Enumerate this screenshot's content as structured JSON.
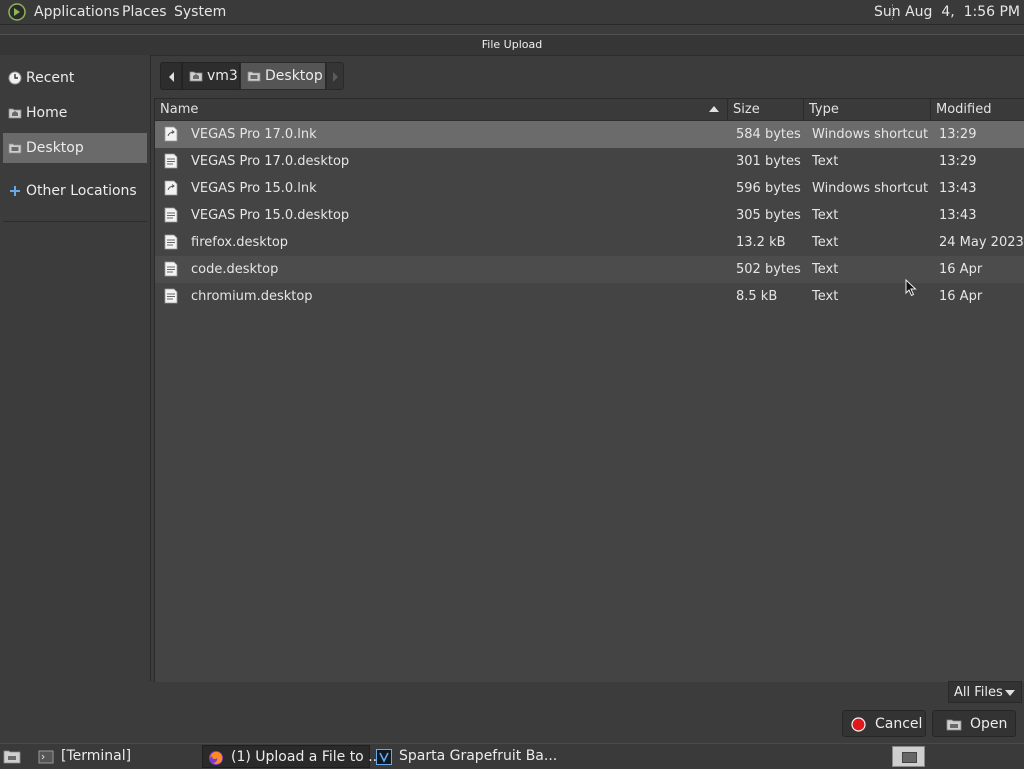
{
  "panel": {
    "menus": [
      "Applications",
      "Places",
      "System"
    ],
    "clock": "Sun Aug  4,  1:56 PM"
  },
  "dialog": {
    "title": "File Upload"
  },
  "sidebar": {
    "items": [
      {
        "label": "Recent",
        "icon": "recent-icon"
      },
      {
        "label": "Home",
        "icon": "home-folder-icon"
      },
      {
        "label": "Desktop",
        "icon": "desktop-folder-icon",
        "selected": true
      },
      {
        "label": "Other Locations",
        "icon": "plus-icon"
      }
    ]
  },
  "pathbar": {
    "segments": [
      "vm3",
      "Desktop"
    ],
    "current": "Desktop"
  },
  "filelist": {
    "columns": [
      "Name",
      "Size",
      "Type",
      "Modified"
    ],
    "sort_column": "Name",
    "sort_order": "ascending",
    "rows": [
      {
        "name": "VEGAS Pro 17.0.lnk",
        "size": "584 bytes",
        "type": "Windows shortcut",
        "modified": "13:29",
        "icon": "shortcut-file-icon",
        "state": "selected"
      },
      {
        "name": "VEGAS Pro 17.0.desktop",
        "size": "301 bytes",
        "type": "Text",
        "modified": "13:29",
        "icon": "text-file-icon"
      },
      {
        "name": "VEGAS Pro 15.0.lnk",
        "size": "596 bytes",
        "type": "Windows shortcut",
        "modified": "13:43",
        "icon": "shortcut-file-icon"
      },
      {
        "name": "VEGAS Pro 15.0.desktop",
        "size": "305 bytes",
        "type": "Text",
        "modified": "13:43",
        "icon": "text-file-icon"
      },
      {
        "name": "firefox.desktop",
        "size": "13.2 kB",
        "type": "Text",
        "modified": "24 May 2023",
        "icon": "text-file-icon"
      },
      {
        "name": "code.desktop",
        "size": "502 bytes",
        "type": "Text",
        "modified": "16 Apr",
        "icon": "text-file-icon",
        "state": "hovered"
      },
      {
        "name": "chromium.desktop",
        "size": "8.5 kB",
        "type": "Text",
        "modified": "16 Apr",
        "icon": "text-file-icon"
      }
    ]
  },
  "filter": {
    "selected": "All Files"
  },
  "actions": {
    "cancel_label": "Cancel",
    "open_label": "Open"
  },
  "taskbar": {
    "tasks": [
      {
        "label": "[Terminal]",
        "icon": "terminal-icon"
      },
      {
        "label": "(1) Upload a File to ...",
        "icon": "firefox-icon",
        "active": true
      },
      {
        "label": "Sparta Grapefruit Ba...",
        "icon": "vegas-icon"
      }
    ]
  },
  "colors": {
    "selection": "#6b6b6b",
    "cancel_red": "#e0181b",
    "accent_blue": "#6aa8e8"
  }
}
